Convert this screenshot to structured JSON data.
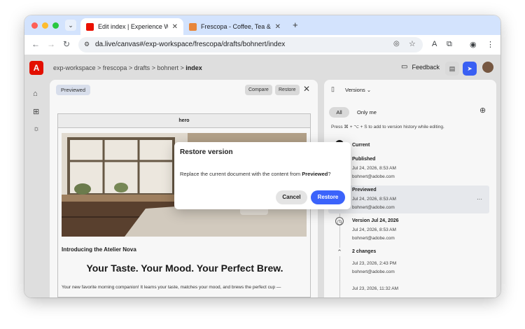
{
  "browser": {
    "tabs": [
      {
        "title": "Edit index | Experience Workspace",
        "active": true
      },
      {
        "title": "Frescopa - Coffee, Tea & Accessories",
        "active": false
      }
    ],
    "url": "da.live/canvas#/exp-workspace/frescopa/drafts/bohnert/index",
    "new_tab": "+",
    "close": "✕"
  },
  "app": {
    "logo_letter": "A",
    "breadcrumb": {
      "parts": [
        "exp-workspace",
        "frescopa",
        "drafts",
        "bohnert"
      ],
      "current": "index",
      "sep": ">"
    },
    "feedback_label": "Feedback"
  },
  "preview": {
    "badge": "Previewed",
    "compare_label": "Compare",
    "restore_label": "Restore",
    "block_name": "hero",
    "intro": "Introducing the Atelier Nova",
    "headline": "Your Taste. Your Mood. Your Perfect Brew.",
    "body": "Your new favorite morning companion! It learns your taste, matches your mood, and brews the perfect cup —"
  },
  "versions": {
    "title": "Versions",
    "filter_all": "All",
    "filter_me": "Only me",
    "hint": "Press ⌘ + ⌥ + S to add to version history while editing.",
    "items": [
      {
        "title": "Current",
        "date": "",
        "author": ""
      },
      {
        "title": "Published",
        "date": "Jul 24, 2026, 8:53 AM",
        "author": "bohnert@adobe.com"
      },
      {
        "title": "Previewed",
        "date": "Jul 24, 2026, 8:53 AM",
        "author": "bohnert@adobe.com"
      },
      {
        "title": "Version Jul 24, 2026",
        "date": "Jul 24, 2026, 8:53 AM",
        "author": "bohnert@adobe.com"
      },
      {
        "title": "2 changes",
        "date": "Jul 23, 2026, 2:43 PM",
        "author": "bohnert@adobe.com"
      },
      {
        "title": "",
        "date": "Jul 23, 2026, 11:32 AM",
        "author": ""
      }
    ]
  },
  "dialog": {
    "title": "Restore version",
    "message_prefix": "Replace the current document with the content from ",
    "message_target": "Previewed",
    "message_suffix": "?",
    "cancel_label": "Cancel",
    "restore_label": "Restore"
  },
  "colors": {
    "accent": "#3b63fb",
    "brand": "#eb1000",
    "tabstrip": "#d3e3fd"
  }
}
